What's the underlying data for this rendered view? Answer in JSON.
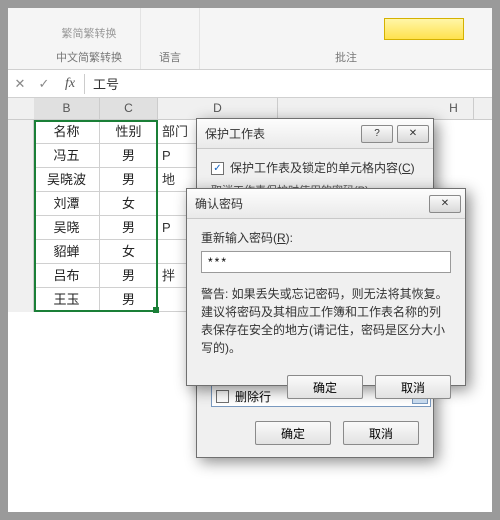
{
  "ribbon": {
    "group1_top": "繁简繁转换",
    "group1_label": "中文简繁转换",
    "group2_label": "语言",
    "group3_label": "批注"
  },
  "formula_bar": {
    "content": "工号"
  },
  "columns": {
    "B": "B",
    "C": "C",
    "D": "D",
    "H": "H"
  },
  "table": {
    "headers": {
      "B": "名称",
      "C": "性别",
      "D": "部门"
    },
    "rows": [
      {
        "B": "冯五",
        "C": "男",
        "D": "P"
      },
      {
        "B": "吴晓波",
        "C": "男",
        "D": "地"
      },
      {
        "B": "刘潭",
        "C": "女",
        "D": ""
      },
      {
        "B": "吴晓",
        "C": "男",
        "D": "P"
      },
      {
        "B": "貂蝉",
        "C": "女",
        "D": ""
      },
      {
        "B": "吕布",
        "C": "男",
        "D": "拌"
      },
      {
        "B": "王玉",
        "C": "男",
        "D": ""
      }
    ]
  },
  "protect_dialog": {
    "title": "保护工作表",
    "checkbox_label_a": "保护工作表及锁定的单元格内容(",
    "checkbox_label_u": "C",
    "checkbox_label_b": ")",
    "pw_label": "取消工作表保护时使用的密码(P):",
    "dropdown_value": "删除行",
    "ok": "确定",
    "cancel": "取消"
  },
  "confirm_dialog": {
    "title": "确认密码",
    "label_a": "重新输入密码(",
    "label_u": "R",
    "label_b": "):",
    "value_masked": "***",
    "warning": "警告: 如果丢失或忘记密码，则无法将其恢复。建议将密码及其相应工作簿和工作表名称的列表保存在安全的地方(请记住，密码是区分大小写的)。",
    "ok": "确定",
    "cancel": "取消"
  }
}
